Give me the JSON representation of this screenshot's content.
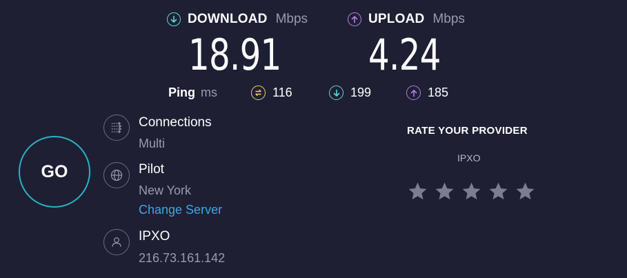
{
  "colors": {
    "background": "#1e1f33",
    "download_accent": "#5dd8d0",
    "upload_accent": "#b57ce6",
    "ping_accent": "#f2d45a",
    "go_ring": "#2ab3c6",
    "link": "#3ea6e8",
    "star": "#7c7d8f"
  },
  "download": {
    "icon": "download-arrow-icon",
    "label": "DOWNLOAD",
    "unit": "Mbps",
    "value": "18.91"
  },
  "upload": {
    "icon": "upload-arrow-icon",
    "label": "UPLOAD",
    "unit": "Mbps",
    "value": "4.24"
  },
  "ping": {
    "label": "Ping",
    "unit": "ms",
    "idle": {
      "icon": "ping-idle-icon",
      "value": "116"
    },
    "download": {
      "icon": "download-arrow-icon",
      "value": "199"
    },
    "upload": {
      "icon": "upload-arrow-icon",
      "value": "185"
    }
  },
  "go_button": {
    "label": "GO"
  },
  "connections": {
    "icon": "connections-icon",
    "title": "Connections",
    "value": "Multi"
  },
  "server": {
    "icon": "globe-icon",
    "title": "Pilot",
    "location": "New York",
    "change_label": "Change Server"
  },
  "provider": {
    "icon": "user-icon",
    "title": "IPXO",
    "ip": "216.73.161.142"
  },
  "rating": {
    "title": "RATE YOUR PROVIDER",
    "provider": "IPXO",
    "stars_total": 5,
    "stars_selected": 0
  }
}
